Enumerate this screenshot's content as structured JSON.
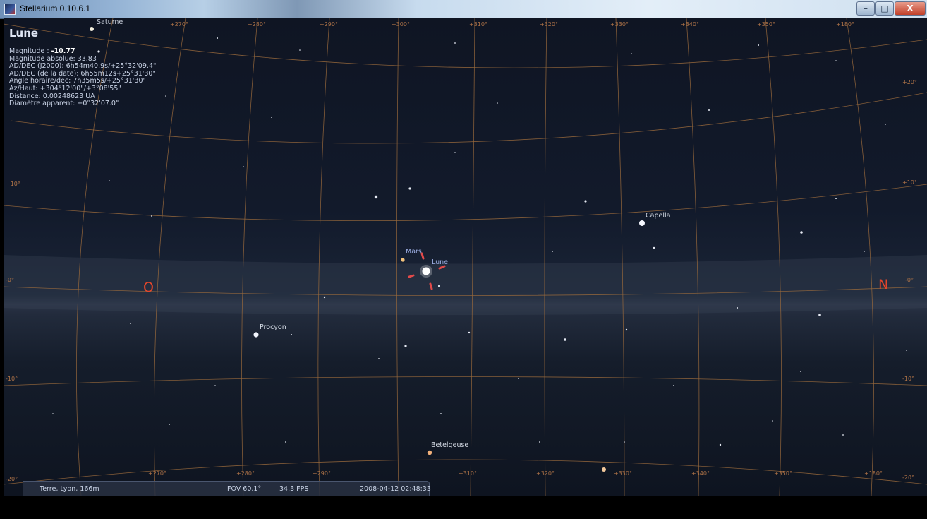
{
  "window": {
    "title": "Stellarium 0.10.6.1",
    "buttons": {
      "minimize": "–",
      "maximize": "□",
      "close": "X"
    }
  },
  "info": {
    "name": "Lune",
    "magnitude_label": "Magnitude :",
    "magnitude_value": "-10.77",
    "lines": [
      "Magnitude absolue: 33.83",
      "AD/DEC (J2000): 6h54m40.9s/+25°32'09.4\"",
      "AD/DEC (de la date): 6h55m12s+25°31'30\"",
      "Angle horaire/dec: 7h35m5s/+25°31'30\"",
      "Az/Haut: +304°12'00\"/+3°08'55\"",
      "Distance: 0.00248623 UA",
      "Diamètre apparent: +0°32'07.0\""
    ]
  },
  "sky_labels": {
    "saturne": "Saturne",
    "mars": "Mars",
    "lune": "Lune",
    "capella": "Capella",
    "procyon": "Procyon",
    "betelgeuse": "Betelgeuse"
  },
  "cardinals": {
    "west": "O",
    "north": "N"
  },
  "grid_labels": {
    "alt_left": [
      "+10°",
      "-0°",
      "-10°",
      "-20°"
    ],
    "alt_right": [
      "+20°",
      "+10°",
      "-0°",
      "-10°",
      "-20°"
    ],
    "az_top": [
      "+270°",
      "+280°",
      "+290°",
      "+300°",
      "+310°",
      "+320°",
      "+330°",
      "+340°",
      "+350°",
      "+180°"
    ],
    "az_bottom": [
      "+270°",
      "+280°",
      "+290°",
      "+310°",
      "+320°",
      "+330°",
      "+340°",
      "+350°",
      "+180°"
    ]
  },
  "status": {
    "location": "Terre, Lyon, 166m",
    "fov": "FOV 60.1°",
    "fps": "34.3 FPS",
    "datetime": "2008-04-12  02:48:33"
  },
  "colors": {
    "grid": "#9a6a3c",
    "cardinal": "#e2462b",
    "planet_label": "#9fb1e6",
    "star_label": "#d9dfe9",
    "selection": "#e14a4a"
  }
}
